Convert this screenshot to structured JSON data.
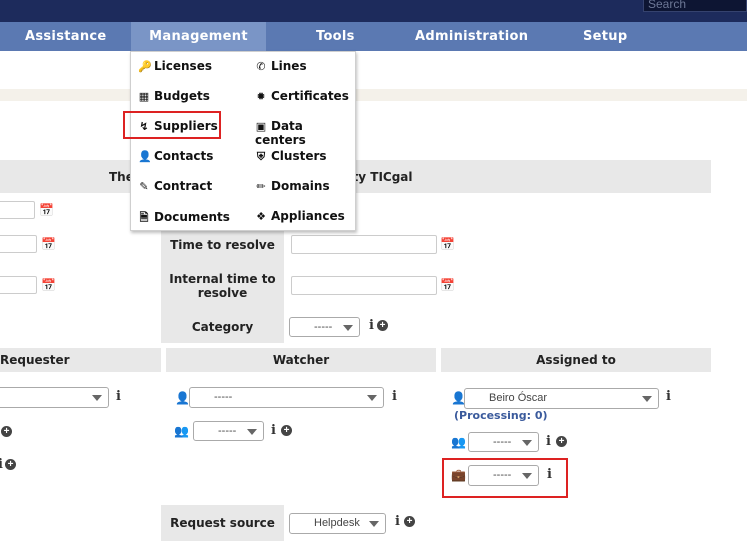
{
  "topbar": {
    "search_placeholder": "Search"
  },
  "menu": {
    "assistance": "Assistance",
    "management": "Management",
    "tools": "Tools",
    "administration": "Administration",
    "setup": "Setup"
  },
  "management_menu": {
    "left": [
      "Licenses",
      "Budgets",
      "Suppliers",
      "Contacts",
      "Contract",
      "Documents"
    ],
    "right": [
      "Lines",
      "Certificates",
      "Data centers",
      "Clusters",
      "Domains",
      "Appliances"
    ]
  },
  "form": {
    "entity_notice": "The tickets will be added in the entity TICgal",
    "time_to_resolve": "Time to resolve",
    "internal_time_to_resolve": "Internal time to resolve",
    "category": "Category",
    "category_value": "-----",
    "request_source": "Request source",
    "request_source_value": "Helpdesk"
  },
  "actors": {
    "requester": "Requester",
    "watcher": "Watcher",
    "assigned_to": "Assigned to",
    "watcher_user": "-----",
    "watcher_group": "-----",
    "assigned_user": "Beiro Óscar",
    "processing": "(Processing: 0)",
    "assigned_group": "-----",
    "assigned_supplier": "-----"
  },
  "icons": {
    "info": "i",
    "plus": "+",
    "calendar": "calendar-icon"
  },
  "colors": {
    "topbar": "#1d2b5c",
    "menubar": "#5b79b2",
    "menu_active": "#7a95c6",
    "highlight": "#dd2222"
  }
}
